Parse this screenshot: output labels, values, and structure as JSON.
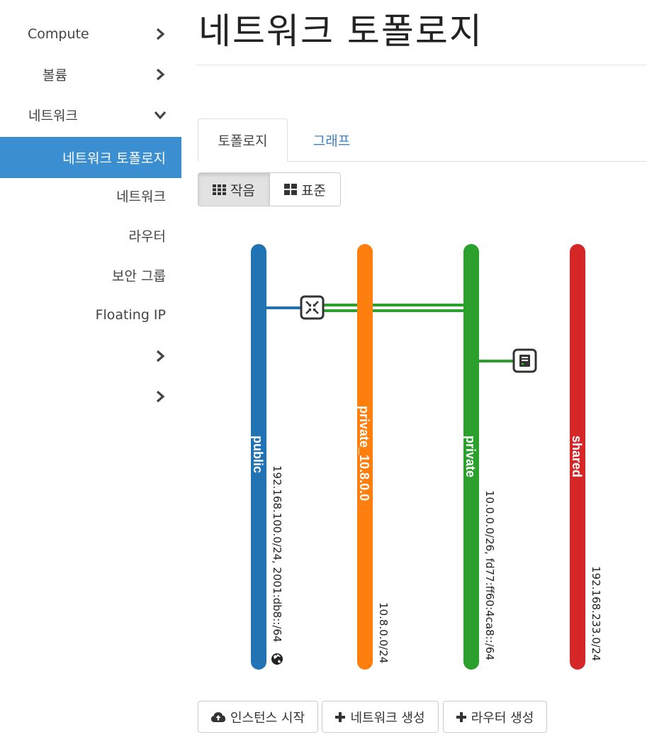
{
  "sidebar": {
    "items": [
      {
        "label": "Compute"
      },
      {
        "label": "볼륨"
      },
      {
        "label": "네트워크"
      },
      {
        "label": "네트워크 토폴로지"
      },
      {
        "label": "네트워크"
      },
      {
        "label": "라우터"
      },
      {
        "label": "보안 그룹"
      },
      {
        "label": "Floating IP"
      },
      {
        "label": ""
      },
      {
        "label": ""
      }
    ]
  },
  "page": {
    "title": "네트워크 토폴로지"
  },
  "tabs": [
    {
      "label": "토폴로지"
    },
    {
      "label": "그래프"
    }
  ],
  "view_toggle": {
    "small": "작음",
    "normal": "표준"
  },
  "topology": {
    "networks": [
      {
        "name": "public",
        "cidr": "192.168.100.0/24, 2001:db8::/64",
        "color": "#2273b4",
        "external": true
      },
      {
        "name": "private_10.8.0.0",
        "cidr": "10.8.0.0/24",
        "color": "#ff7f0e"
      },
      {
        "name": "private",
        "cidr": "10.0.0.0/26, fd77:ff60:4ca8::/64",
        "color": "#2ca02c"
      },
      {
        "name": "shared",
        "cidr": "192.168.233.0/24",
        "color": "#d62728"
      }
    ],
    "devices": [
      {
        "type": "router",
        "icon": "router-icon",
        "connected_to": [
          "public",
          "private_10.8.0.0",
          "private"
        ]
      },
      {
        "type": "instance",
        "icon": "server-icon",
        "connected_to": [
          "private"
        ]
      }
    ]
  },
  "actions": {
    "launch_instance": "인스턴스 시작",
    "create_network": "네트워크 생성",
    "create_router": "라우터 생성"
  },
  "colors": {
    "active_sidebar": "#3b8ed0",
    "tab_link": "#3b7fc4"
  }
}
